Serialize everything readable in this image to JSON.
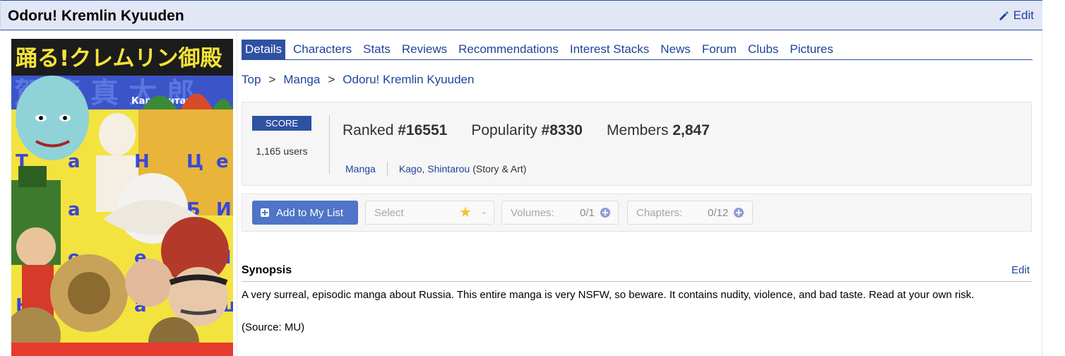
{
  "header": {
    "title": "Odoru! Kremlin Kyuuden",
    "edit_label": "Edit"
  },
  "cover": {
    "title_jp": "踊る!クレムリン御殿",
    "author_jp": "駕籠真太郎",
    "author_cyr": "Кагосинтаро",
    "dominant_colors": [
      "#f5e33a",
      "#e63b2e",
      "#3a4fc9",
      "#8fd3d9",
      "#3d8a3a"
    ]
  },
  "tabs": [
    {
      "label": "Details",
      "active": true
    },
    {
      "label": "Characters",
      "active": false
    },
    {
      "label": "Stats",
      "active": false
    },
    {
      "label": "Reviews",
      "active": false
    },
    {
      "label": "Recommendations",
      "active": false
    },
    {
      "label": "Interest Stacks",
      "active": false
    },
    {
      "label": "News",
      "active": false
    },
    {
      "label": "Forum",
      "active": false
    },
    {
      "label": "Clubs",
      "active": false
    },
    {
      "label": "Pictures",
      "active": false
    }
  ],
  "breadcrumb": {
    "items": [
      "Top",
      "Manga",
      "Odoru! Kremlin Kyuuden"
    ],
    "separator": ">"
  },
  "stats": {
    "score_label": "SCORE",
    "users": "1,165 users",
    "ranked_label": "Ranked",
    "ranked_value": "#16551",
    "popularity_label": "Popularity",
    "popularity_value": "#8330",
    "members_label": "Members",
    "members_value": "2,847",
    "type": "Manga",
    "author": "Kago, Shintarou",
    "author_role": "(Story & Art)"
  },
  "list": {
    "add_label": "Add to My List",
    "select_placeholder": "Select",
    "volumes_label": "Volumes:",
    "volumes_value": "0/1",
    "chapters_label": "Chapters:",
    "chapters_value": "0/12"
  },
  "synopsis": {
    "heading": "Synopsis",
    "edit_label": "Edit",
    "text": "A very surreal, episodic manga about Russia. This entire manga is very NSFW, so beware. It contains nudity, violence, and bad taste. Read at your own risk.",
    "source": "(Source: MU)"
  },
  "colors": {
    "accent": "#2e51a2",
    "link": "#1d439b",
    "header_bg": "#e1e7f5",
    "button": "#4f74c8"
  }
}
